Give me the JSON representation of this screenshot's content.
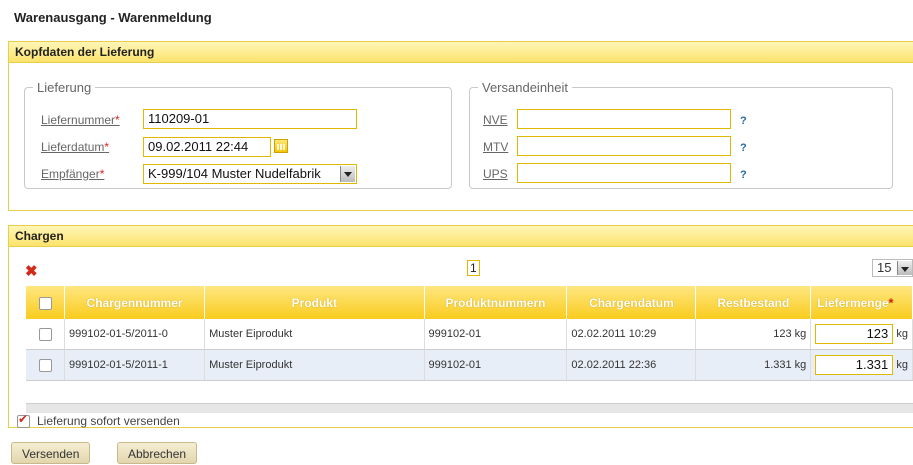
{
  "title": "Warenausgang - Warenmeldung",
  "kopf": {
    "header": "Kopfdaten der Lieferung",
    "lieferung": {
      "legend": "Lieferung",
      "liefernummer_label": "Liefernummer",
      "liefernummer_value": "110209-01",
      "lieferdatum_label": "Lieferdatum",
      "lieferdatum_value": "09.02.2011 22:44",
      "empfaenger_label": "Empfänger",
      "empfaenger_value": "K-999/104 Muster Nudelfabrik",
      "required_mark": "*"
    },
    "versand": {
      "legend": "Versandeinheit",
      "nve_label": "NVE",
      "mtv_label": "MTV",
      "ups_label": "UPS",
      "help": "?"
    }
  },
  "chargen": {
    "header": "Chargen",
    "page": "1",
    "per_page": "15",
    "columns": [
      "Chargennummer",
      "Produkt",
      "Produktnummern",
      "Chargendatum",
      "Restbestand",
      "Liefermenge"
    ],
    "required_mark": "*",
    "rows": [
      {
        "charge": "999102-01-5/2011-0",
        "produkt": "Muster Eiprodukt",
        "nummer": "999102-01",
        "datum": "02.02.2011 10:29",
        "rest": "123 kg",
        "menge": "123",
        "unit": "kg"
      },
      {
        "charge": "999102-01-5/2011-1",
        "produkt": "Muster Eiprodukt",
        "nummer": "999102-01",
        "datum": "02.02.2011 22:36",
        "rest": "1.331 kg",
        "menge": "1.331",
        "unit": "kg"
      }
    ]
  },
  "footer": {
    "send_now_label": "Lieferung sofort versenden",
    "send_now_checked": true,
    "versenden": "Versenden",
    "abbrechen": "Abbrechen"
  },
  "colors": {
    "accent": "#f9cc1d",
    "border": "#e8cf4a",
    "required": "#dd2222",
    "delete": "#d42a1a"
  },
  "icons": [
    "calendar-icon",
    "dropdown-arrow-icon",
    "delete-icon",
    "help-icon",
    "checkbox-icon"
  ]
}
